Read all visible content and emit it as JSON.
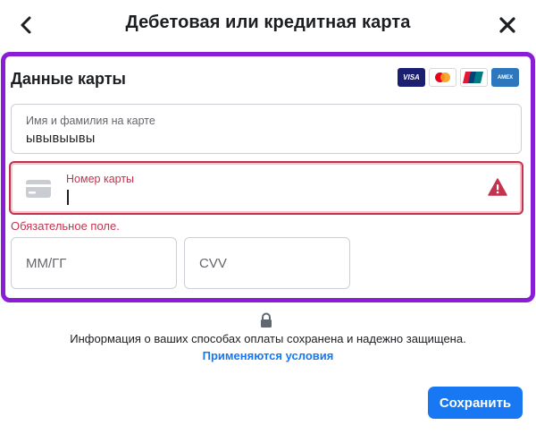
{
  "header": {
    "title": "Дебетовая или кредитная карта",
    "back_icon": "chevron-left-icon",
    "close_icon": "close-icon"
  },
  "card_section": {
    "title": "Данные карты",
    "brands": [
      "VISA",
      "Mastercard",
      "UnionPay",
      "AMEX"
    ],
    "name_field": {
      "label": "Имя и фамилия на карте",
      "value": "ывывыывы"
    },
    "number_field": {
      "label": "Номер карты",
      "value": "",
      "error": "Обязательное поле."
    },
    "expiry_field": {
      "placeholder": "ММ/ГГ"
    },
    "cvv_field": {
      "placeholder": "CVV"
    }
  },
  "footer": {
    "info_text": "Информация о ваших способах оплаты сохранена и надежно защищена.",
    "terms_link": "Применяются условия",
    "save_label": "Сохранить"
  },
  "colors": {
    "accent": "#1877f2",
    "highlight_border": "#8a1dd6",
    "error": "#c4334d"
  }
}
